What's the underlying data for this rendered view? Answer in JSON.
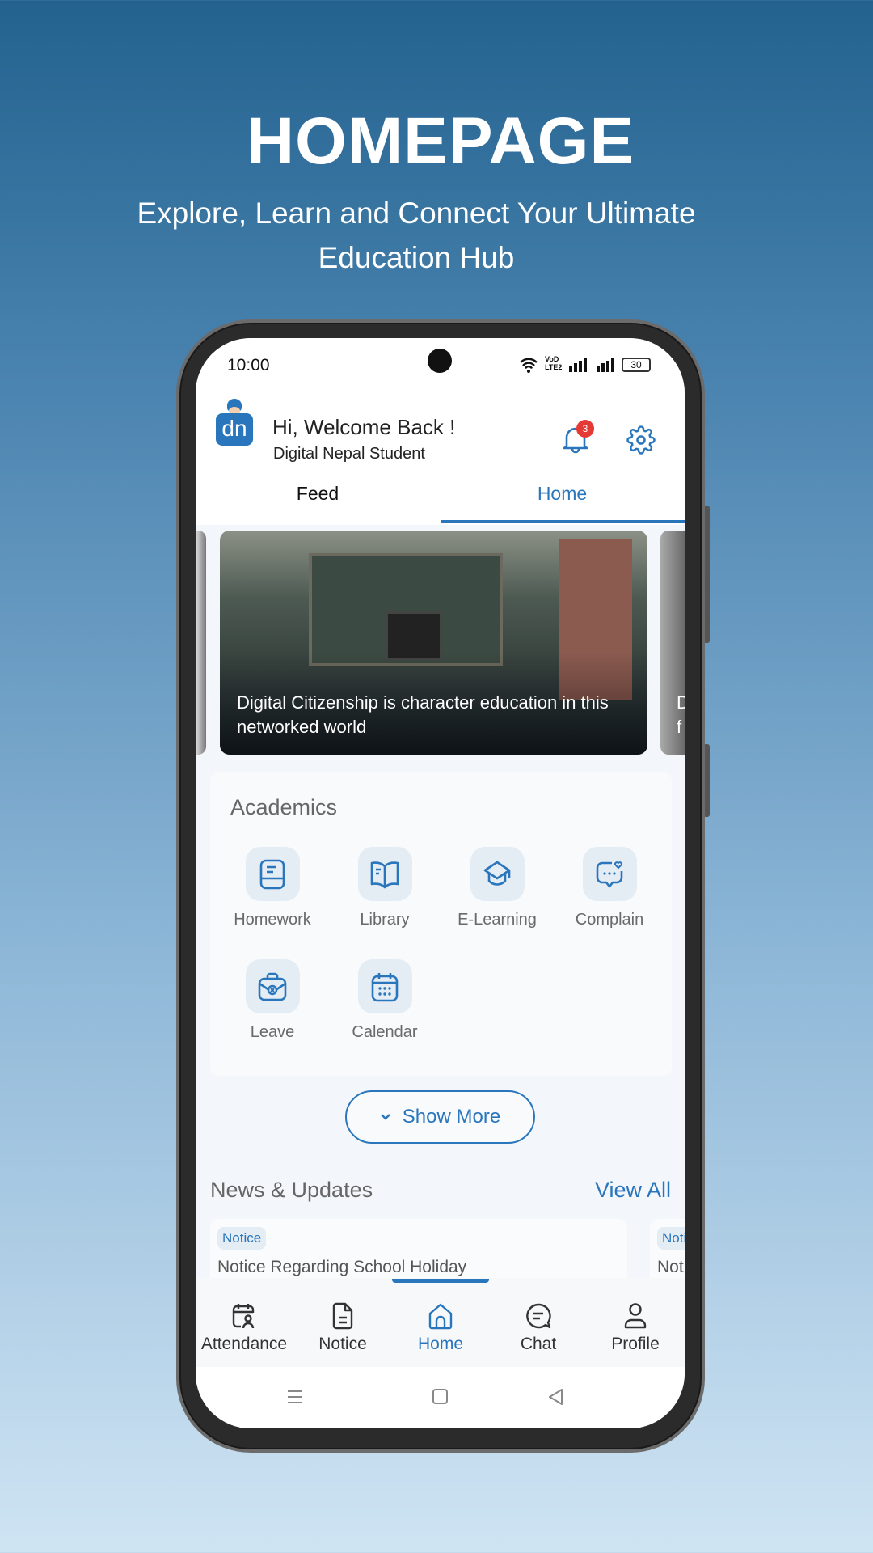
{
  "hero": {
    "title": "HOMEPAGE",
    "subtitle": "Explore, Learn and Connect Your Ultimate Education Hub"
  },
  "status_bar": {
    "time": "10:00",
    "network": "VoD LTE2",
    "battery": "30"
  },
  "header": {
    "logo_text": "dn",
    "greeting": "Hi, Welcome Back !",
    "subtitle": "Digital Nepal Student",
    "notification_count": "3"
  },
  "tabs": [
    {
      "label": "Feed",
      "active": false
    },
    {
      "label": "Home",
      "active": true
    }
  ],
  "carousel": {
    "caption": "Digital Citizenship is character education in this networked world",
    "next_caption_peek": "D f"
  },
  "academics": {
    "title": "Academics",
    "items": [
      {
        "label": "Homework",
        "icon": "homework-icon"
      },
      {
        "label": "Library",
        "icon": "book-open-icon"
      },
      {
        "label": "E-Learning",
        "icon": "graduation-cap-icon"
      },
      {
        "label": "Complain",
        "icon": "chat-heart-icon"
      },
      {
        "label": "Leave",
        "icon": "briefcase-x-icon"
      },
      {
        "label": "Calendar",
        "icon": "calendar-icon"
      }
    ]
  },
  "show_more": "Show More",
  "news": {
    "title": "News & Updates",
    "view_all": "View All",
    "items": [
      {
        "badge": "Notice",
        "title": "Notice Regarding School Holiday"
      },
      {
        "badge": "Notice",
        "title": "Notice"
      }
    ]
  },
  "bottom_nav": [
    {
      "label": "Attendance",
      "active": false
    },
    {
      "label": "Notice",
      "active": false
    },
    {
      "label": "Home",
      "active": true
    },
    {
      "label": "Chat",
      "active": false
    },
    {
      "label": "Profile",
      "active": false
    }
  ],
  "colors": {
    "accent": "#2a76bd",
    "badge_red": "#e53935",
    "text_gray": "#6a6a6a"
  }
}
